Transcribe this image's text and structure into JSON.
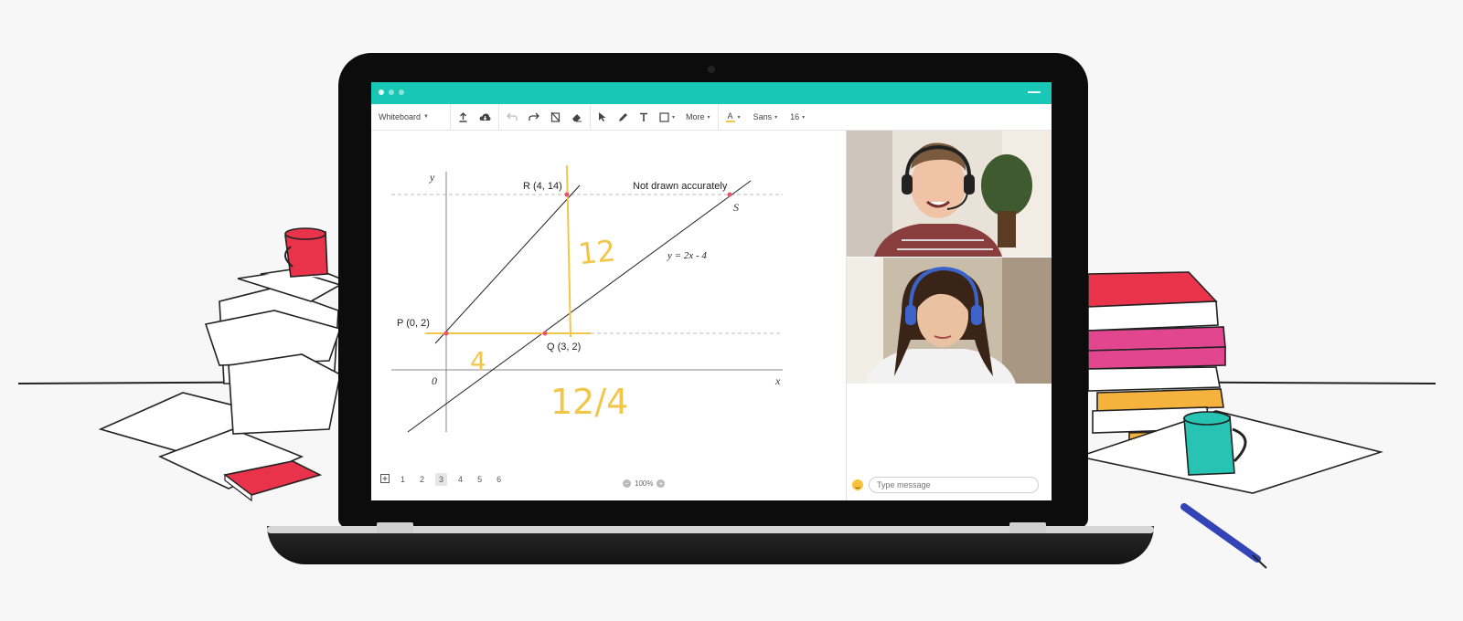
{
  "window": {
    "title_dots": 3
  },
  "toolbar": {
    "board_menu": "Whiteboard",
    "more_label": "More",
    "font_color_label": "A",
    "font_family": "Sans",
    "font_size": "16"
  },
  "graph": {
    "y_axis": "y",
    "x_axis": "x",
    "origin": "0",
    "point_r": "R (4, 14)",
    "point_p": "P (0, 2)",
    "point_q": "Q (3, 2)",
    "point_s": "S",
    "note": "Not drawn accurately",
    "equation": "y = 2x - 4",
    "hand_12": "12",
    "hand_4": "4",
    "hand_ratio": "12/4"
  },
  "pager": {
    "pages": [
      "1",
      "2",
      "3",
      "4",
      "5",
      "6"
    ],
    "active": "3"
  },
  "zoom": {
    "minus": "−",
    "level": "100%",
    "plus": "+"
  },
  "chat": {
    "placeholder": "Type message"
  },
  "colors": {
    "accent": "#18c7b6",
    "handwriting": "#f2c649",
    "red": "#e8334a",
    "pink": "#e2468f",
    "teal_mug": "#27c4b4"
  }
}
